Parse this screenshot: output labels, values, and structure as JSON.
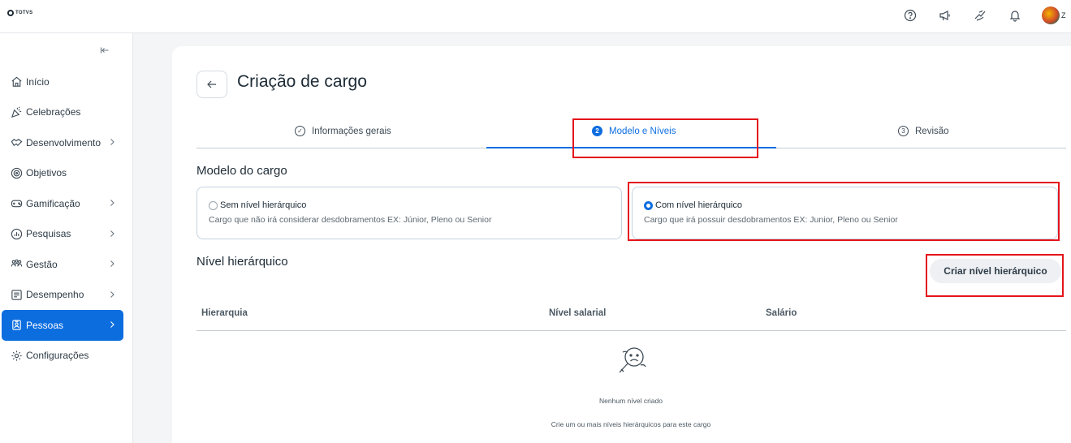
{
  "brand": {
    "logo_text": "TOTVS",
    "accent": "#0c6ddf",
    "highlight": "#e4141b"
  },
  "topbar": {
    "icons": [
      "help-icon",
      "megaphone-icon",
      "hand-icon",
      "bell-icon"
    ],
    "avatar_text": "Z"
  },
  "sidebar": {
    "collapse_icon": "collapse-left-icon",
    "items": [
      {
        "label": "Início",
        "icon": "home-icon",
        "chevron": false
      },
      {
        "label": "Celebrações",
        "icon": "party-icon",
        "chevron": false
      },
      {
        "label": "Desenvolvimento",
        "icon": "handshake-icon",
        "chevron": true
      },
      {
        "label": "Objetivos",
        "icon": "target-icon",
        "chevron": false
      },
      {
        "label": "Gamificação",
        "icon": "gamepad-icon",
        "chevron": true
      },
      {
        "label": "Pesquisas",
        "icon": "survey-icon",
        "chevron": true
      },
      {
        "label": "Gestão",
        "icon": "people-icon",
        "chevron": true
      },
      {
        "label": "Desempenho",
        "icon": "chart-board-icon",
        "chevron": true
      },
      {
        "label": "Pessoas",
        "icon": "badge-icon",
        "chevron": true,
        "active": true
      },
      {
        "label": "Configurações",
        "icon": "gear-icon",
        "chevron": false
      }
    ]
  },
  "page": {
    "title": "Criação de cargo",
    "steps": [
      {
        "num": "✓",
        "label": "Informações gerais"
      },
      {
        "num": "2",
        "label": "Modelo e Níveis",
        "active": true
      },
      {
        "num": "3",
        "label": "Revisão"
      }
    ],
    "model_section": {
      "title": "Modelo do cargo",
      "options": [
        {
          "label": "Sem nível hierárquico",
          "desc": "Cargo que não irá considerar desdobramentos EX: Júnior, Pleno ou Senior",
          "selected": false
        },
        {
          "label": "Com nível hierárquico",
          "desc": "Cargo que irá possuir desdobramentos EX: Junior, Pleno ou Senior",
          "selected": true
        }
      ]
    },
    "level_section": {
      "title": "Nível hierárquico",
      "create_button": "Criar nível hierárquico",
      "columns": [
        "Hierarquia",
        "Nível salarial",
        "Salário"
      ],
      "empty_title": "Nenhum nível criado",
      "empty_desc": "Crie um ou mais níveis hierárquicos para este cargo"
    }
  }
}
